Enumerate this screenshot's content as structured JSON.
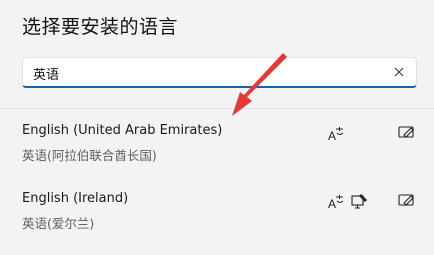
{
  "header": {
    "title": "选择要安装的语言"
  },
  "search": {
    "value": "英语"
  },
  "icons": {
    "clear": "close-icon",
    "text_to_speech": "text-to-speech-icon",
    "handwriting": "handwriting-icon",
    "edit": "edit-icon"
  },
  "colors": {
    "accent": "#1864a9",
    "annotation_arrow": "#e53935"
  },
  "languages": [
    {
      "name": "English (United Arab Emirates)",
      "native": "英语(阿拉伯联合酋长国)",
      "features": [
        "text_to_speech"
      ]
    },
    {
      "name": "English (Ireland)",
      "native": "英语(爱尔兰)",
      "features": [
        "text_to_speech",
        "handwriting"
      ]
    }
  ]
}
